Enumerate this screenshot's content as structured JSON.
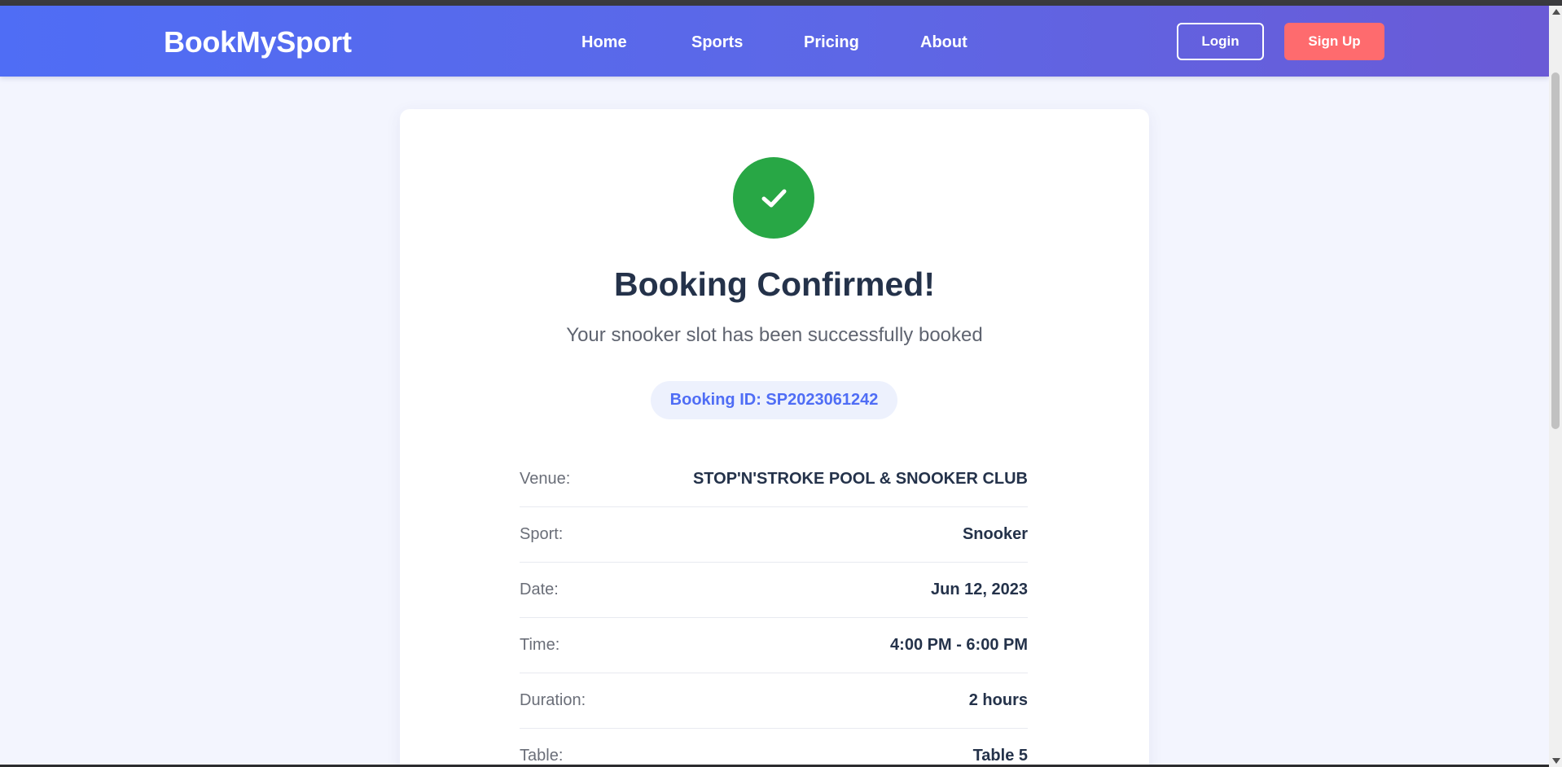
{
  "header": {
    "brand": "BookMySport",
    "nav": {
      "home": "Home",
      "sports": "Sports",
      "pricing": "Pricing",
      "about": "About"
    },
    "login_label": "Login",
    "signup_label": "Sign Up"
  },
  "confirmation": {
    "icon": "check-icon",
    "title": "Booking Confirmed!",
    "subtitle": "Your snooker slot has been successfully booked",
    "booking_id": "Booking ID: SP2023061242"
  },
  "details": [
    {
      "label": "Venue:",
      "value": "STOP'N'STROKE POOL & SNOOKER CLUB"
    },
    {
      "label": "Sport:",
      "value": "Snooker"
    },
    {
      "label": "Date:",
      "value": "Jun 12, 2023"
    },
    {
      "label": "Time:",
      "value": "4:00 PM - 6:00 PM"
    },
    {
      "label": "Duration:",
      "value": "2 hours"
    },
    {
      "label": "Table:",
      "value": "Table 5"
    }
  ],
  "colors": {
    "accent": "#4f6df5",
    "signup": "#fe6b6e",
    "success": "#28a745",
    "heading": "#24324a"
  }
}
